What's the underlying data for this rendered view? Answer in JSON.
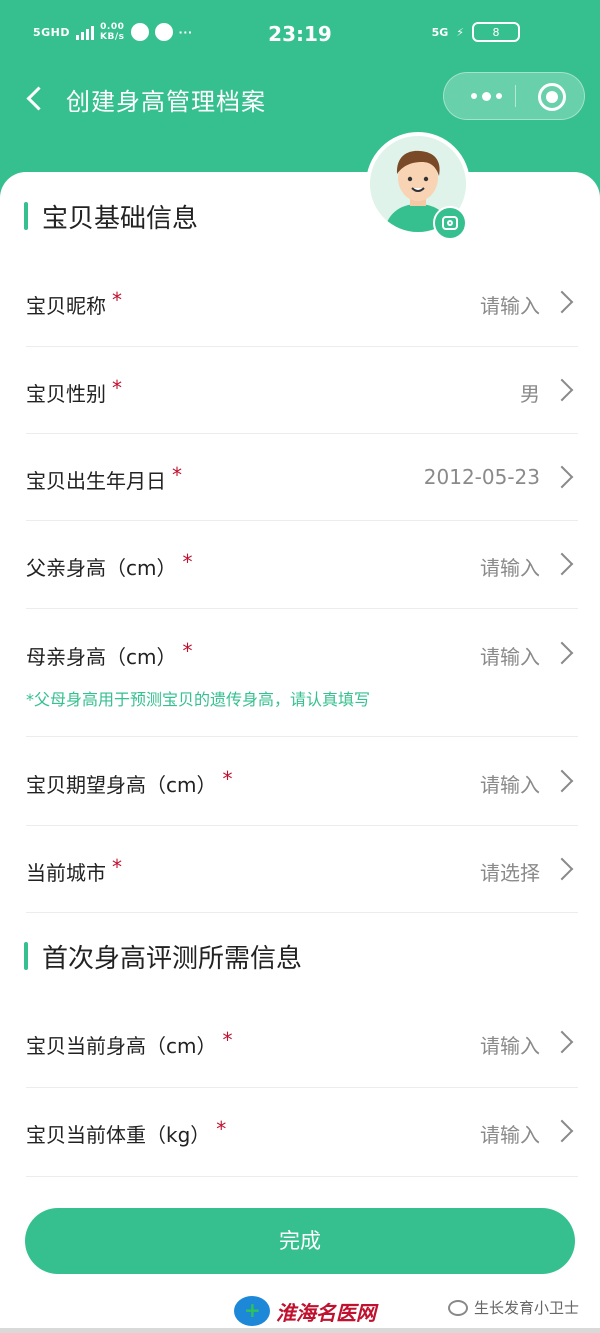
{
  "status_bar": {
    "network": "5GHD",
    "speed": "0.00",
    "speed_unit": "KB/s",
    "time": "23:19",
    "signal_type": "5G",
    "battery": "8"
  },
  "nav": {
    "title": "创建身高管理档案"
  },
  "section_basic": {
    "title": "宝贝基础信息"
  },
  "basic_fields": [
    {
      "label": "宝贝昵称",
      "required": "*",
      "value": "请输入"
    },
    {
      "label": "宝贝性别",
      "required": "*",
      "value": "男"
    },
    {
      "label": "宝贝出生年月日",
      "required": "*",
      "value": "2012-05-23"
    },
    {
      "label": "父亲身高（cm）",
      "required": "*",
      "value": "请输入"
    },
    {
      "label": "母亲身高（cm）",
      "required": "*",
      "value": "请输入"
    },
    {
      "label": "宝贝期望身高（cm）",
      "required": "*",
      "value": "请输入"
    },
    {
      "label": "当前城市",
      "required": "*",
      "value": "请选择"
    }
  ],
  "hint": "*父母身高用于预测宝贝的遗传身高，请认真填写",
  "section_measure": {
    "title": "首次身高评测所需信息"
  },
  "measure_fields": [
    {
      "label": "宝贝当前身高（cm）",
      "required": "*",
      "value": "请输入"
    },
    {
      "label": "宝贝当前体重（kg）",
      "required": "*",
      "value": "请输入"
    }
  ],
  "done_button": "完成",
  "watermark_left": "淮海名医网",
  "watermark_right": "生长发育小卫士",
  "colors": {
    "primary": "#36c08f",
    "required": "#c0112f",
    "value_text": "#8a8a8a"
  }
}
